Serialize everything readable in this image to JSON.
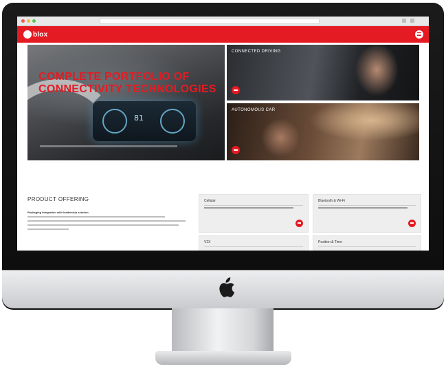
{
  "site": {
    "logo_text": "blox",
    "brand_color": "#e41b23"
  },
  "hero": {
    "title": "Complete portfolio of connectivity technologies",
    "dash_reading": "81"
  },
  "hero_cards": [
    {
      "label": "Connected driving"
    },
    {
      "label": "Autonomous car"
    }
  ],
  "product_offering": {
    "title": "Product offering",
    "subtitle": "Packaging integration with leadership solution"
  },
  "offer_cards": [
    {
      "title": "Cellular"
    },
    {
      "title": "Bluetooth & Wi-Fi"
    },
    {
      "title": "V2X"
    },
    {
      "title": "Position & Time"
    }
  ],
  "icons": {
    "apple_logo": "apple-icon",
    "menu": "hamburger-icon",
    "card_action": "arrow-right-icon"
  }
}
